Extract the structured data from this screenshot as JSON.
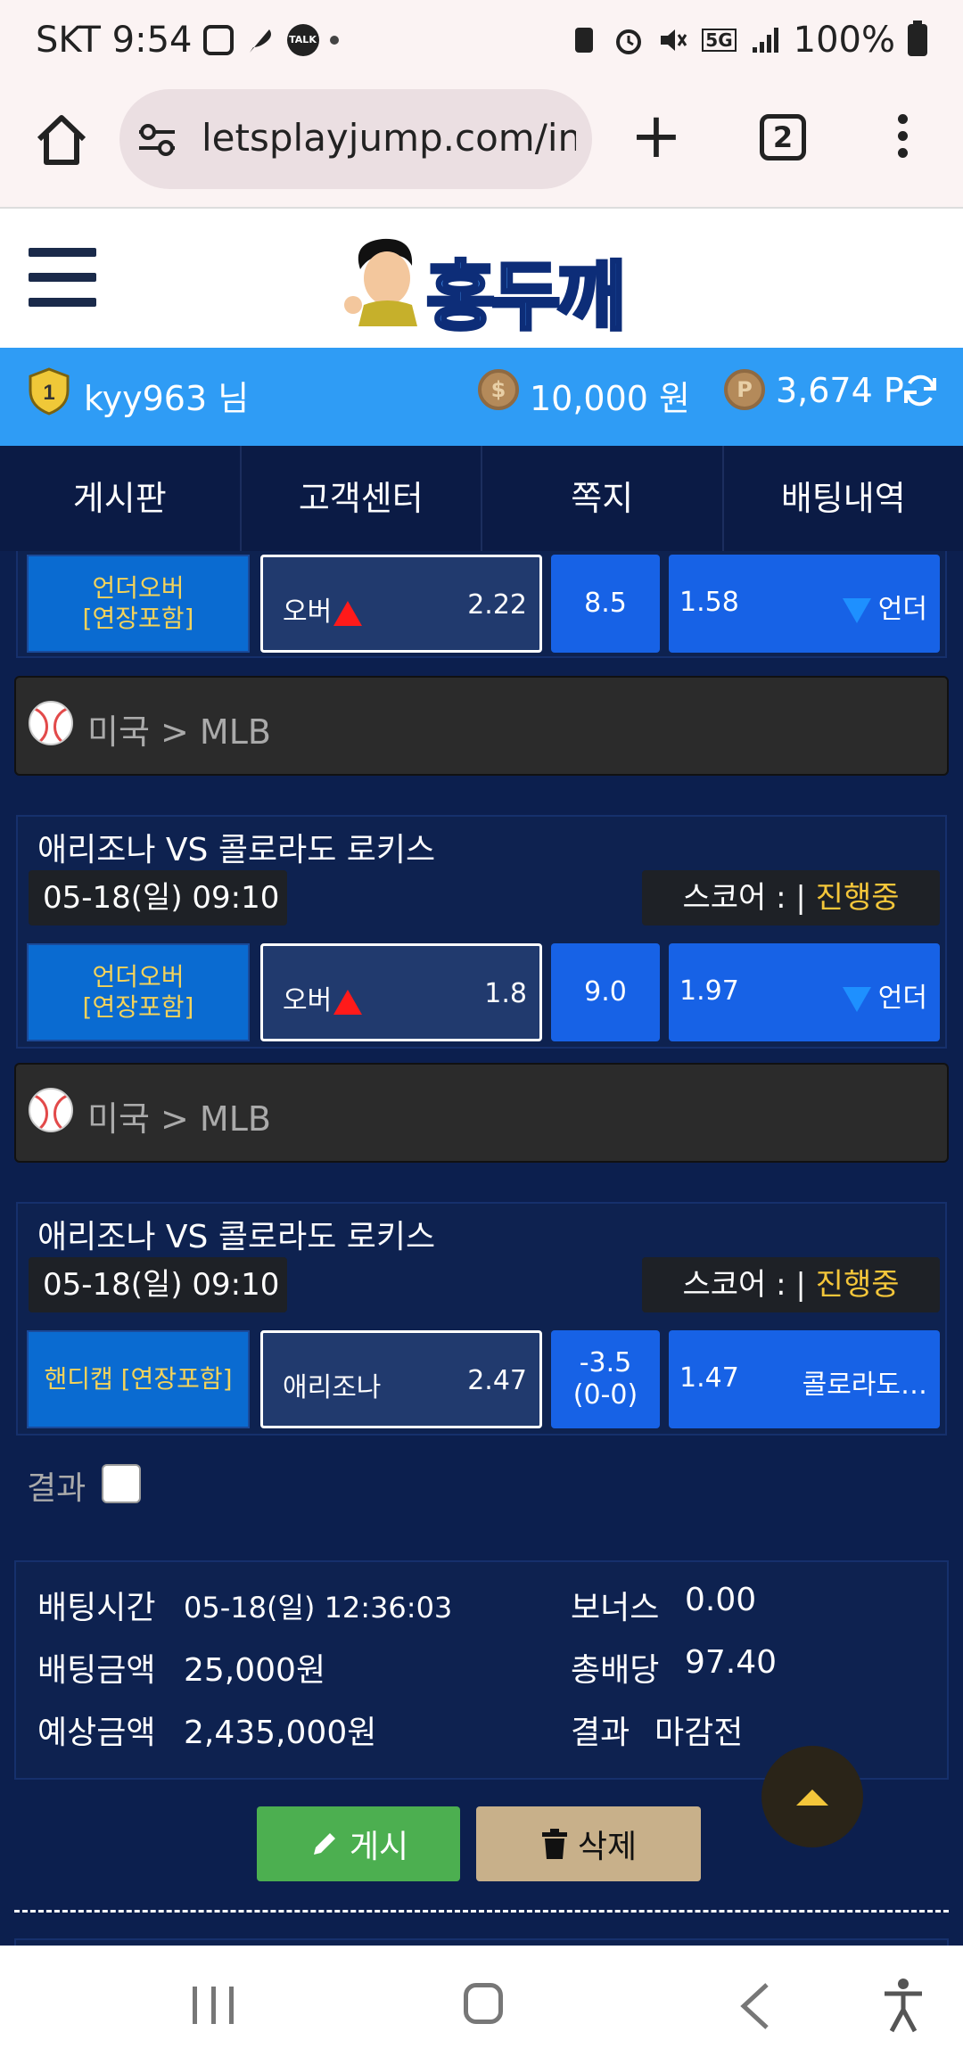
{
  "status_bar": {
    "carrier_time": "SKT 9:54",
    "talk_icon_label": "TALK",
    "network": "5G",
    "battery": "100%"
  },
  "browser": {
    "url": "letsplayjump.com/inc",
    "tab_count": "2"
  },
  "site": {
    "logo_text": "홍두깨"
  },
  "user": {
    "level": "1",
    "name": "kyy963 님",
    "money": "10,000 원",
    "points": "3,674 P",
    "money_coin": "$",
    "point_coin": "P"
  },
  "nav": {
    "items": [
      "게시판",
      "고객센터",
      "쪽지",
      "배팅내역"
    ]
  },
  "bets": [
    {
      "type": "언더오버\n[연장포함]",
      "home_label": "오버",
      "home_odd": "2.22",
      "line": "8.5",
      "away_odd": "1.58",
      "away_label": "언더"
    },
    {
      "league": "미국 > MLB",
      "title": "애리조나 VS 콜로라도 로키스",
      "date": "05-18(일) 09:10",
      "score_label": "스코어 : |",
      "score_status": "진행중",
      "type": "언더오버\n[연장포함]",
      "home_label": "오버",
      "home_odd": "1.8",
      "line": "9.0",
      "away_odd": "1.97",
      "away_label": "언더"
    },
    {
      "league": "미국 > MLB",
      "title": "애리조나 VS 콜로라도 로키스",
      "date": "05-18(일) 09:10",
      "score_label": "스코어 : |",
      "score_status": "진행중",
      "type": "핸디캡 [연장포함]",
      "home_label": "애리조나",
      "home_odd": "2.47",
      "line": "-3.5\n(0-0)",
      "away_odd": "1.47",
      "away_label": "콜로라도…"
    }
  ],
  "result_label": "결과",
  "summary": {
    "bet_time_label": "배팅시간",
    "bet_time": "05-18(일) 12:36:03",
    "bet_amount_label": "배팅금액",
    "bet_amount": "25,000원",
    "expected_label": "예상금액",
    "expected": "2,435,000원",
    "bonus_label": "보너스",
    "bonus": "0.00",
    "total_odds_label": "총배당",
    "total_odds": "97.40",
    "result_label": "결과",
    "result": "마감전"
  },
  "actions": {
    "post": "게시",
    "delete": "삭제"
  },
  "colors": {
    "background": "#0c1f4e",
    "userbar": "#2f9cf5",
    "live": "#f4c63a",
    "post_button": "#4caf50",
    "delete_button": "#c8b08a"
  }
}
